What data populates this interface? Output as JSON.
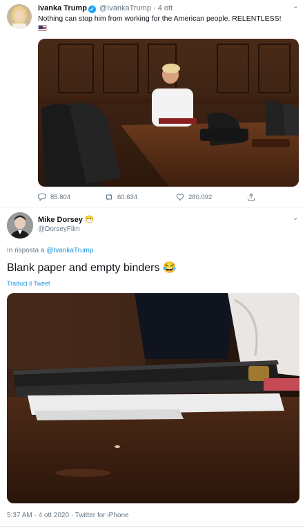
{
  "tweet1": {
    "author_name": "Ivanka Trump",
    "verified_mark": "✔",
    "handle": "@IvankaTrump",
    "separator": "·",
    "time": "4 ott",
    "text": "Nothing can stop him from working for the American people. RELENTLESS!",
    "flag_icon": "us-flag-icon",
    "stats": {
      "replies": "85.804",
      "retweets": "60.634",
      "likes": "280.092"
    }
  },
  "tweet2": {
    "author_name": "Mike Dorsey",
    "emoji": "😷",
    "handle": "@DorseyFilm",
    "reply_prefix": "In risposta a",
    "reply_handle": "@IvankaTrump",
    "text": "Blank paper and empty binders",
    "text_emoji": "😂",
    "translate": "Traduci il Tweet",
    "timestamp": "5:37 AM · 4 ott 2020 · Twitter for iPhone"
  },
  "icons": {
    "chevron": "⌄"
  }
}
